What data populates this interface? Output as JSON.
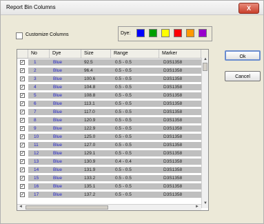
{
  "window": {
    "title": "Report Bin Columns",
    "close_glyph": "X"
  },
  "customize": {
    "label": "Customize Columns",
    "checked": false
  },
  "dye_selector": {
    "label": "Dye:",
    "colors": [
      "#0000ff",
      "#00a000",
      "#ffff00",
      "#ff0000",
      "#ff9900",
      "#9900cc"
    ]
  },
  "table": {
    "columns": [
      "No",
      "Dye",
      "Size",
      "Range",
      "Marker"
    ],
    "rows": [
      {
        "no": "1",
        "dye": "Blue",
        "size": "92.5",
        "range": "0.5 - 0.5",
        "marker": "D3S1358"
      },
      {
        "no": "2",
        "dye": "Blue",
        "size": "96.4",
        "range": "0.5 - 0.5",
        "marker": "D3S1358"
      },
      {
        "no": "3",
        "dye": "Blue",
        "size": "100.6",
        "range": "0.5 - 0.5",
        "marker": "D3S1358"
      },
      {
        "no": "4",
        "dye": "Blue",
        "size": "104.8",
        "range": "0.5 - 0.5",
        "marker": "D3S1358"
      },
      {
        "no": "5",
        "dye": "Blue",
        "size": "108.8",
        "range": "0.5 - 0.5",
        "marker": "D3S1358"
      },
      {
        "no": "6",
        "dye": "Blue",
        "size": "113.1",
        "range": "0.5 - 0.5",
        "marker": "D3S1358"
      },
      {
        "no": "7",
        "dye": "Blue",
        "size": "117.0",
        "range": "0.5 - 0.5",
        "marker": "D3S1358"
      },
      {
        "no": "8",
        "dye": "Blue",
        "size": "120.9",
        "range": "0.5 - 0.5",
        "marker": "D3S1358"
      },
      {
        "no": "9",
        "dye": "Blue",
        "size": "122.9",
        "range": "0.5 - 0.5",
        "marker": "D3S1358"
      },
      {
        "no": "10",
        "dye": "Blue",
        "size": "125.0",
        "range": "0.5 - 0.5",
        "marker": "D3S1358"
      },
      {
        "no": "11",
        "dye": "Blue",
        "size": "127.0",
        "range": "0.5 - 0.5",
        "marker": "D3S1358"
      },
      {
        "no": "12",
        "dye": "Blue",
        "size": "129.1",
        "range": "0.5 - 0.5",
        "marker": "D3S1358"
      },
      {
        "no": "13",
        "dye": "Blue",
        "size": "130.9",
        "range": "0.4 - 0.4",
        "marker": "D3S1358"
      },
      {
        "no": "14",
        "dye": "Blue",
        "size": "131.9",
        "range": "0.5 - 0.5",
        "marker": "D3S1358"
      },
      {
        "no": "15",
        "dye": "Blue",
        "size": "133.2",
        "range": "0.5 - 0.5",
        "marker": "D3S1358"
      },
      {
        "no": "16",
        "dye": "Blue",
        "size": "135.1",
        "range": "0.5 - 0.5",
        "marker": "D3S1358"
      },
      {
        "no": "17",
        "dye": "Blue",
        "size": "137.2",
        "range": "0.5 - 0.5",
        "marker": "D3S1358"
      }
    ]
  },
  "buttons": {
    "ok": "Ok",
    "cancel": "Cancel"
  }
}
